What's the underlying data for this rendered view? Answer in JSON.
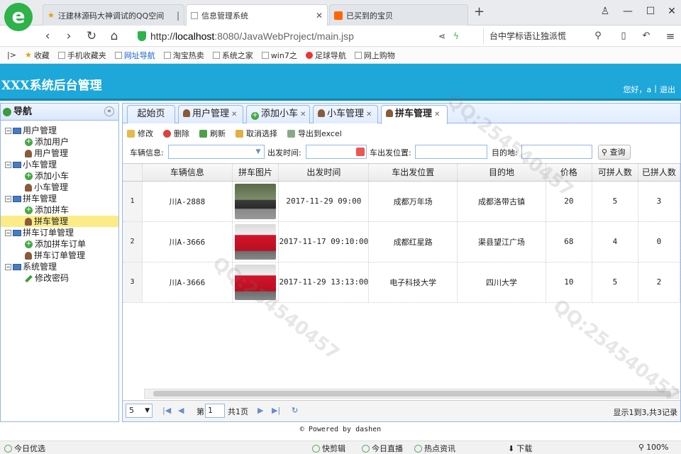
{
  "browser": {
    "tabs": [
      {
        "label": "汪建林源码大神调试的QQ空间",
        "active": false
      },
      {
        "label": "信息管理系统",
        "active": true
      },
      {
        "label": "已买到的宝贝",
        "active": false
      }
    ],
    "url_prefix": "http://",
    "url_host": "localhost",
    "url_path": ":8080/JavaWebProject/main.jsp",
    "search_text": "台中学标语让独派慌",
    "bookmarks": [
      "收藏",
      "手机收藏夹",
      "网址导航",
      "淘宝热卖",
      "系统之家",
      "win7之",
      "足球导航",
      "网上购物"
    ]
  },
  "app": {
    "title": "XXX系统后台管理",
    "greeting": "您好，a",
    "logout": "退出"
  },
  "nav": {
    "title": "导航",
    "groups": [
      {
        "label": "用户管理",
        "items": [
          {
            "label": "添加用户",
            "icon": "add"
          },
          {
            "label": "用户管理",
            "icon": "user"
          }
        ]
      },
      {
        "label": "小车管理",
        "items": [
          {
            "label": "添加小车",
            "icon": "add"
          },
          {
            "label": "小车管理",
            "icon": "user"
          }
        ]
      },
      {
        "label": "拼车管理",
        "items": [
          {
            "label": "添加拼车",
            "icon": "add"
          },
          {
            "label": "拼车管理",
            "icon": "user",
            "selected": true
          }
        ]
      },
      {
        "label": "拼车订单管理",
        "items": [
          {
            "label": "添加拼车订单",
            "icon": "add"
          },
          {
            "label": "拼车订单管理",
            "icon": "user"
          }
        ]
      },
      {
        "label": "系统管理",
        "items": [
          {
            "label": "修改密码",
            "icon": "pen"
          }
        ]
      }
    ]
  },
  "panel_tabs": [
    {
      "label": "起始页",
      "closable": false,
      "icon": ""
    },
    {
      "label": "用户管理",
      "closable": true,
      "icon": "user"
    },
    {
      "label": "添加小车",
      "closable": true,
      "icon": "add"
    },
    {
      "label": "小车管理",
      "closable": true,
      "icon": "user"
    },
    {
      "label": "拼车管理",
      "closable": true,
      "icon": "user",
      "active": true
    }
  ],
  "toolbar": {
    "edit": "修改",
    "delete": "删除",
    "refresh": "刷新",
    "cancel_select": "取消选择",
    "export": "导出到excel"
  },
  "filters": {
    "car_info_label": "车辆信息:",
    "depart_time_label": "出发时间:",
    "depart_place_label": "车出发位置:",
    "destination_label": "目的地:",
    "query": "查询"
  },
  "grid": {
    "columns": [
      "车辆信息",
      "拼车图片",
      "出发时间",
      "车出发位置",
      "目的地",
      "价格",
      "可拼人数",
      "已拼人数"
    ],
    "rows": [
      {
        "rownum": "1",
        "car": "川A-2888",
        "image": "car-dark",
        "time": "2017-11-29 09:00",
        "from": "成都万年场",
        "to": "成都洛带古镇",
        "price": "20",
        "capacity": "5",
        "joined": "3"
      },
      {
        "rownum": "2",
        "car": "川A-3666",
        "image": "car-red",
        "time": "2017-11-17 09:10:00",
        "from": "成都红星路",
        "to": "渠县望江广场",
        "price": "68",
        "capacity": "4",
        "joined": "0"
      },
      {
        "rownum": "3",
        "car": "川A-3666",
        "image": "car-red",
        "time": "2017-11-29 13:13:00",
        "from": "电子科技大学",
        "to": "四川大学",
        "price": "10",
        "capacity": "5",
        "joined": "2"
      }
    ]
  },
  "pager": {
    "page_size": "5",
    "page_label": "第",
    "page_value": "1",
    "page_total": "共1页",
    "info": "显示1到3,共3记录"
  },
  "footer": "Powered by dashen",
  "statusbar": {
    "left": "今日优选",
    "items": [
      "快剪辑",
      "今日直播",
      "热点资讯",
      "下载",
      "100%"
    ]
  },
  "watermark": "QQ:254540457"
}
